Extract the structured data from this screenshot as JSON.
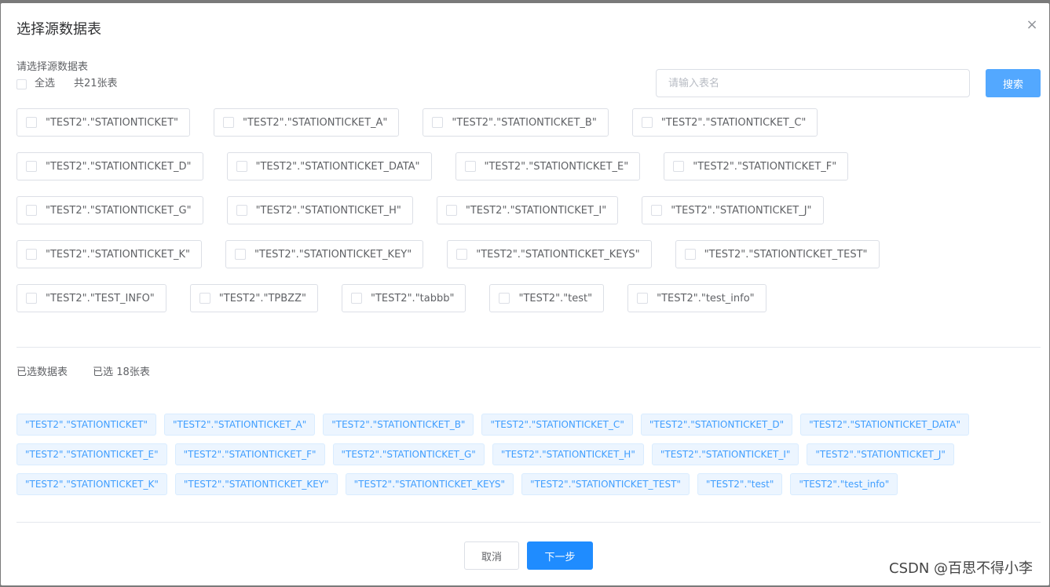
{
  "dialog": {
    "title": "选择源数据表",
    "close_label": "×"
  },
  "source": {
    "prompt": "请选择源数据表",
    "select_all_label": "全选",
    "total_label": "共21张表",
    "search_placeholder": "请输入表名",
    "search_value": "",
    "search_button": "搜索",
    "rows": [
      [
        "\"TEST2\".\"STATIONTICKET\"",
        "\"TEST2\".\"STATIONTICKET_A\"",
        "\"TEST2\".\"STATIONTICKET_B\"",
        "\"TEST2\".\"STATIONTICKET_C\""
      ],
      [
        "\"TEST2\".\"STATIONTICKET_D\"",
        "\"TEST2\".\"STATIONTICKET_DATA\"",
        "\"TEST2\".\"STATIONTICKET_E\"",
        "\"TEST2\".\"STATIONTICKET_F\""
      ],
      [
        "\"TEST2\".\"STATIONTICKET_G\"",
        "\"TEST2\".\"STATIONTICKET_H\"",
        "\"TEST2\".\"STATIONTICKET_I\"",
        "\"TEST2\".\"STATIONTICKET_J\""
      ],
      [
        "\"TEST2\".\"STATIONTICKET_K\"",
        "\"TEST2\".\"STATIONTICKET_KEY\"",
        "\"TEST2\".\"STATIONTICKET_KEYS\"",
        "\"TEST2\".\"STATIONTICKET_TEST\""
      ],
      [
        "\"TEST2\".\"TEST_INFO\"",
        "\"TEST2\".\"TPBZZ\"",
        "\"TEST2\".\"tabbb\"",
        "\"TEST2\".\"test\"",
        "\"TEST2\".\"test_info\""
      ]
    ]
  },
  "selected": {
    "label": "已选数据表",
    "count_label": "已选 18张表",
    "rows": [
      [
        "\"TEST2\".\"STATIONTICKET\"",
        "\"TEST2\".\"STATIONTICKET_A\"",
        "\"TEST2\".\"STATIONTICKET_B\"",
        "\"TEST2\".\"STATIONTICKET_C\"",
        "\"TEST2\".\"STATIONTICKET_D\"",
        "\"TEST2\".\"STATIONTICKET_DATA\""
      ],
      [
        "\"TEST2\".\"STATIONTICKET_E\"",
        "\"TEST2\".\"STATIONTICKET_F\"",
        "\"TEST2\".\"STATIONTICKET_G\"",
        "\"TEST2\".\"STATIONTICKET_H\"",
        "\"TEST2\".\"STATIONTICKET_I\"",
        "\"TEST2\".\"STATIONTICKET_J\""
      ],
      [
        "\"TEST2\".\"STATIONTICKET_K\"",
        "\"TEST2\".\"STATIONTICKET_KEY\"",
        "\"TEST2\".\"STATIONTICKET_KEYS\"",
        "\"TEST2\".\"STATIONTICKET_TEST\"",
        "\"TEST2\".\"test\"",
        "\"TEST2\".\"test_info\""
      ]
    ]
  },
  "footer": {
    "cancel_label": "取消",
    "next_label": "下一步"
  },
  "watermark": "CSDN @百思不得小李",
  "colors": {
    "primary": "#409eff",
    "tag_bg": "#ecf5ff",
    "border": "#dcdfe6"
  }
}
